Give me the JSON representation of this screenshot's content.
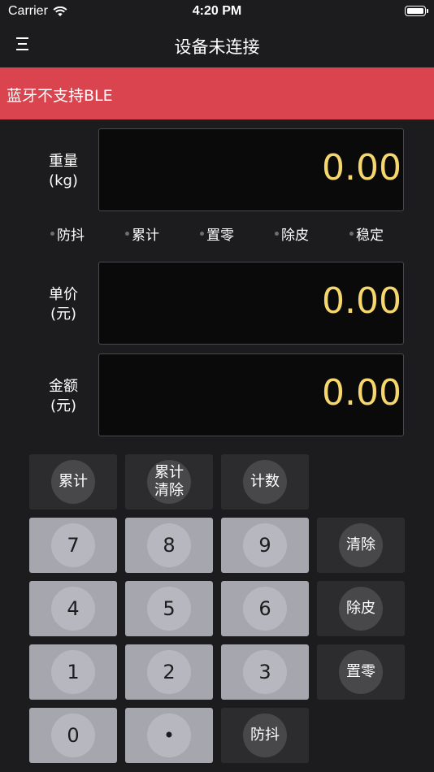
{
  "status_bar": {
    "carrier": "Carrier",
    "time": "4:20 PM"
  },
  "nav": {
    "title": "设备未连接"
  },
  "alert": {
    "message": "蓝牙不支持BLE"
  },
  "weight": {
    "label_line1": "重量",
    "label_line2": "(kg)",
    "value": "0.00"
  },
  "indicators": [
    "防抖",
    "累计",
    "置零",
    "除皮",
    "稳定"
  ],
  "unit_price": {
    "label_line1": "单价",
    "label_line2": "(元)",
    "value": "0.00"
  },
  "amount": {
    "label_line1": "金额",
    "label_line2": "(元)",
    "value": "0.00"
  },
  "keypad": {
    "accumulate": "累计",
    "clear_accumulate_line1": "累计",
    "clear_accumulate_line2": "清除",
    "count": "计数",
    "digits": [
      "7",
      "8",
      "9",
      "4",
      "5",
      "6",
      "1",
      "2",
      "3",
      "0"
    ],
    "dot": "•",
    "clear": "清除",
    "tare": "除皮",
    "zero": "置零",
    "anti_shake": "防抖"
  },
  "colors": {
    "background": "#1c1c1e",
    "alert": "#d9444e",
    "display_value": "#f5d76e",
    "digit_key": "#a5a6ae",
    "function_key": "#2c2c2e"
  }
}
